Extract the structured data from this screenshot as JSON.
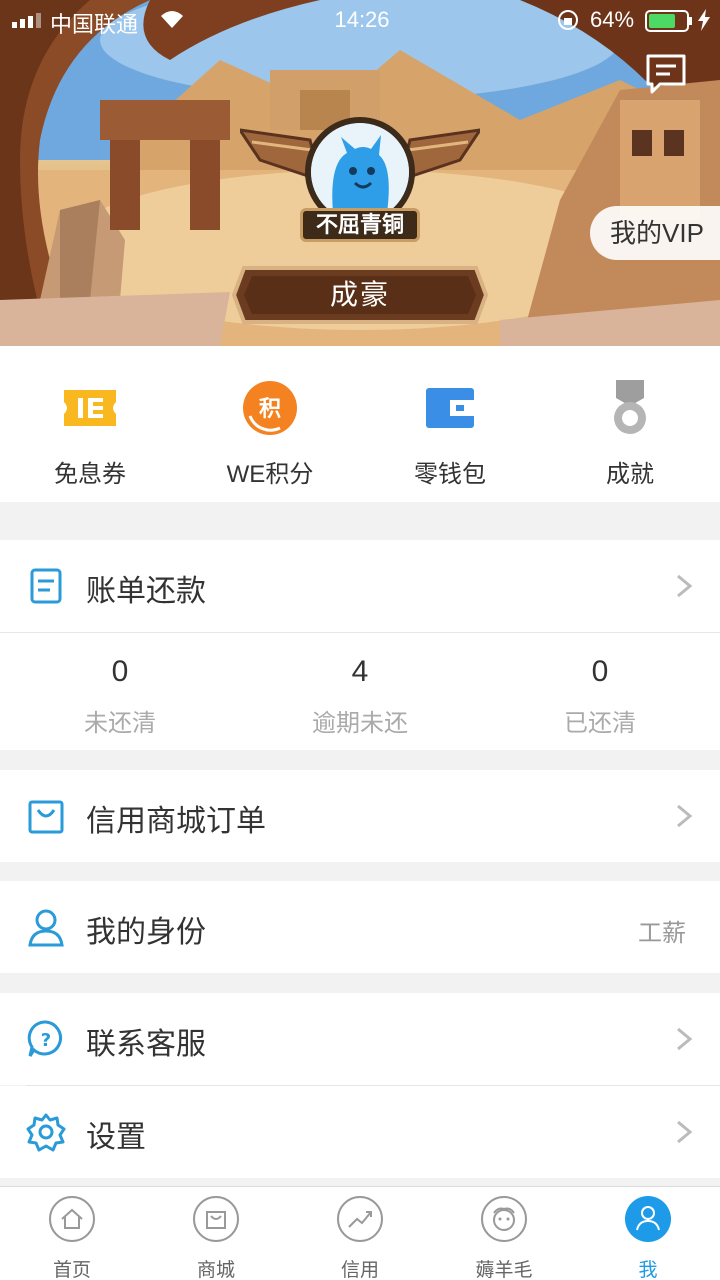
{
  "status_bar": {
    "carrier": "中国联通",
    "time": "14:26",
    "battery_percent": "64%"
  },
  "header": {
    "vip_label": "我的VIP",
    "rank_badge": "不屈青铜",
    "user_name": "成豪",
    "message_icon": "message-icon"
  },
  "quick_actions": [
    {
      "label": "免息券",
      "icon": "coupon-icon",
      "color": "#f9b81f"
    },
    {
      "label": "WE积分",
      "icon": "points-icon",
      "color": "#f58220"
    },
    {
      "label": "零钱包",
      "icon": "wallet-icon",
      "color": "#3a8ee6"
    },
    {
      "label": "成就",
      "icon": "medal-icon",
      "color": "#a8a8a8"
    }
  ],
  "bill": {
    "label": "账单还款",
    "stats": [
      {
        "value": "0",
        "label": "未还清"
      },
      {
        "value": "4",
        "label": "逾期未还"
      },
      {
        "value": "0",
        "label": "已还清"
      }
    ]
  },
  "menu": {
    "orders_label": "信用商城订单",
    "identity_label": "我的身份",
    "identity_value": "工薪",
    "service_label": "联系客服",
    "settings_label": "设置"
  },
  "tabs": [
    {
      "label": "首页",
      "icon": "home-icon"
    },
    {
      "label": "商城",
      "icon": "shop-icon"
    },
    {
      "label": "信用",
      "icon": "credit-icon"
    },
    {
      "label": "薅羊毛",
      "icon": "sheep-icon"
    },
    {
      "label": "我",
      "icon": "profile-icon",
      "active": true
    }
  ],
  "colors": {
    "accent": "#1e9be8",
    "icon_blue": "#2a9ad8"
  }
}
